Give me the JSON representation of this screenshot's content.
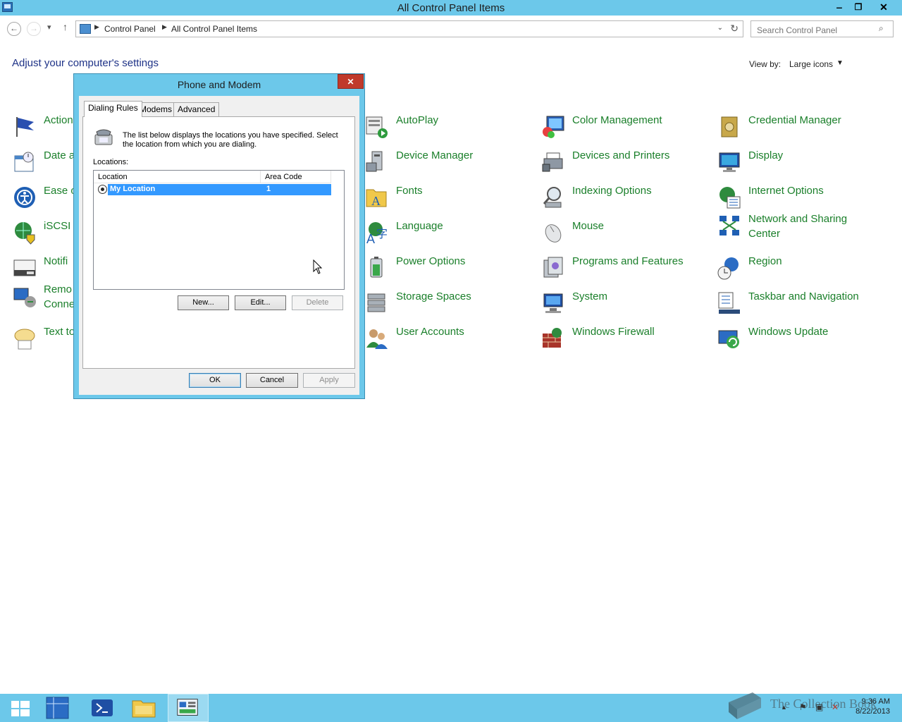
{
  "window": {
    "title": "All Control Panel Items",
    "minimize": "‒",
    "restore": "❐",
    "close": "✕"
  },
  "address": {
    "sep": "▶",
    "crumbs": [
      "Control Panel",
      "All Control Panel Items"
    ],
    "search_placeholder": "Search Control Panel",
    "back": "←",
    "forward": "→",
    "recent": "▾",
    "up": "↑",
    "dropdown": "⌄",
    "refresh": "↻",
    "search_icon": "⌕"
  },
  "content": {
    "heading": "Adjust your computer's settings",
    "view_by_label": "View by:",
    "view_by_value": "Large icons",
    "view_by_arrow": "▼"
  },
  "items": {
    "col1": [
      "Action",
      "Date a",
      "Ease o",
      "iSCSI I",
      "Notifi",
      "Remo\nConne",
      "Text to"
    ],
    "col2": [
      "AutoPlay",
      "Device Manager",
      "Fonts",
      "Language",
      "Power Options",
      "Storage Spaces",
      "User Accounts"
    ],
    "col3": [
      "Color Management",
      "Devices and Printers",
      "Indexing Options",
      "Mouse",
      "Programs and Features",
      "System",
      "Windows Firewall"
    ],
    "col4": [
      "Credential Manager",
      "Display",
      "Internet Options",
      "Network and Sharing\nCenter",
      "Region",
      "Taskbar and Navigation",
      "Windows Update"
    ]
  },
  "dialog": {
    "title": "Phone and Modem",
    "close": "✕",
    "tabs": [
      "Dialing Rules",
      "Modems",
      "Advanced"
    ],
    "description": "The list below displays the locations you have specified. Select the location from which you are dialing.",
    "locations_label": "Locations:",
    "columns": [
      "Location",
      "Area Code"
    ],
    "rows": [
      {
        "location": "My Location",
        "area_code": "1"
      }
    ],
    "buttons": {
      "new": "New...",
      "edit": "Edit...",
      "delete": "Delete",
      "ok": "OK",
      "cancel": "Cancel",
      "apply": "Apply"
    }
  },
  "taskbar": {
    "watermark": "The Collection Book",
    "time": "9:36 AM",
    "date": "8/22/2013",
    "tray_arrow": "▲",
    "tray_flag": "⚑",
    "tray_network": "▣",
    "tray_volume": "✕"
  },
  "icons": {
    "action": "flag-icon",
    "date": "calendar-icon",
    "ease": "ease-of-access-icon",
    "iscsi": "globe-shield-icon",
    "notif": "notification-area-icon",
    "remote": "remote-connection-icon",
    "tts": "speech-bubble-icon",
    "autoplay": "autoplay-icon",
    "device_manager": "device-manager-icon",
    "fonts": "fonts-folder-icon",
    "language": "language-icon",
    "power": "battery-icon",
    "storage": "storage-spaces-icon",
    "users": "users-icon",
    "color": "color-management-icon",
    "devices": "printer-icon",
    "indexing": "indexing-icon",
    "mouse": "mouse-icon",
    "programs": "programs-icon",
    "system": "computer-icon",
    "firewall": "firewall-icon",
    "credential": "vault-icon",
    "display": "display-icon",
    "internet": "internet-options-icon",
    "network": "network-icon",
    "region": "region-icon",
    "taskbar": "taskbar-icon",
    "update": "windows-update-icon"
  }
}
